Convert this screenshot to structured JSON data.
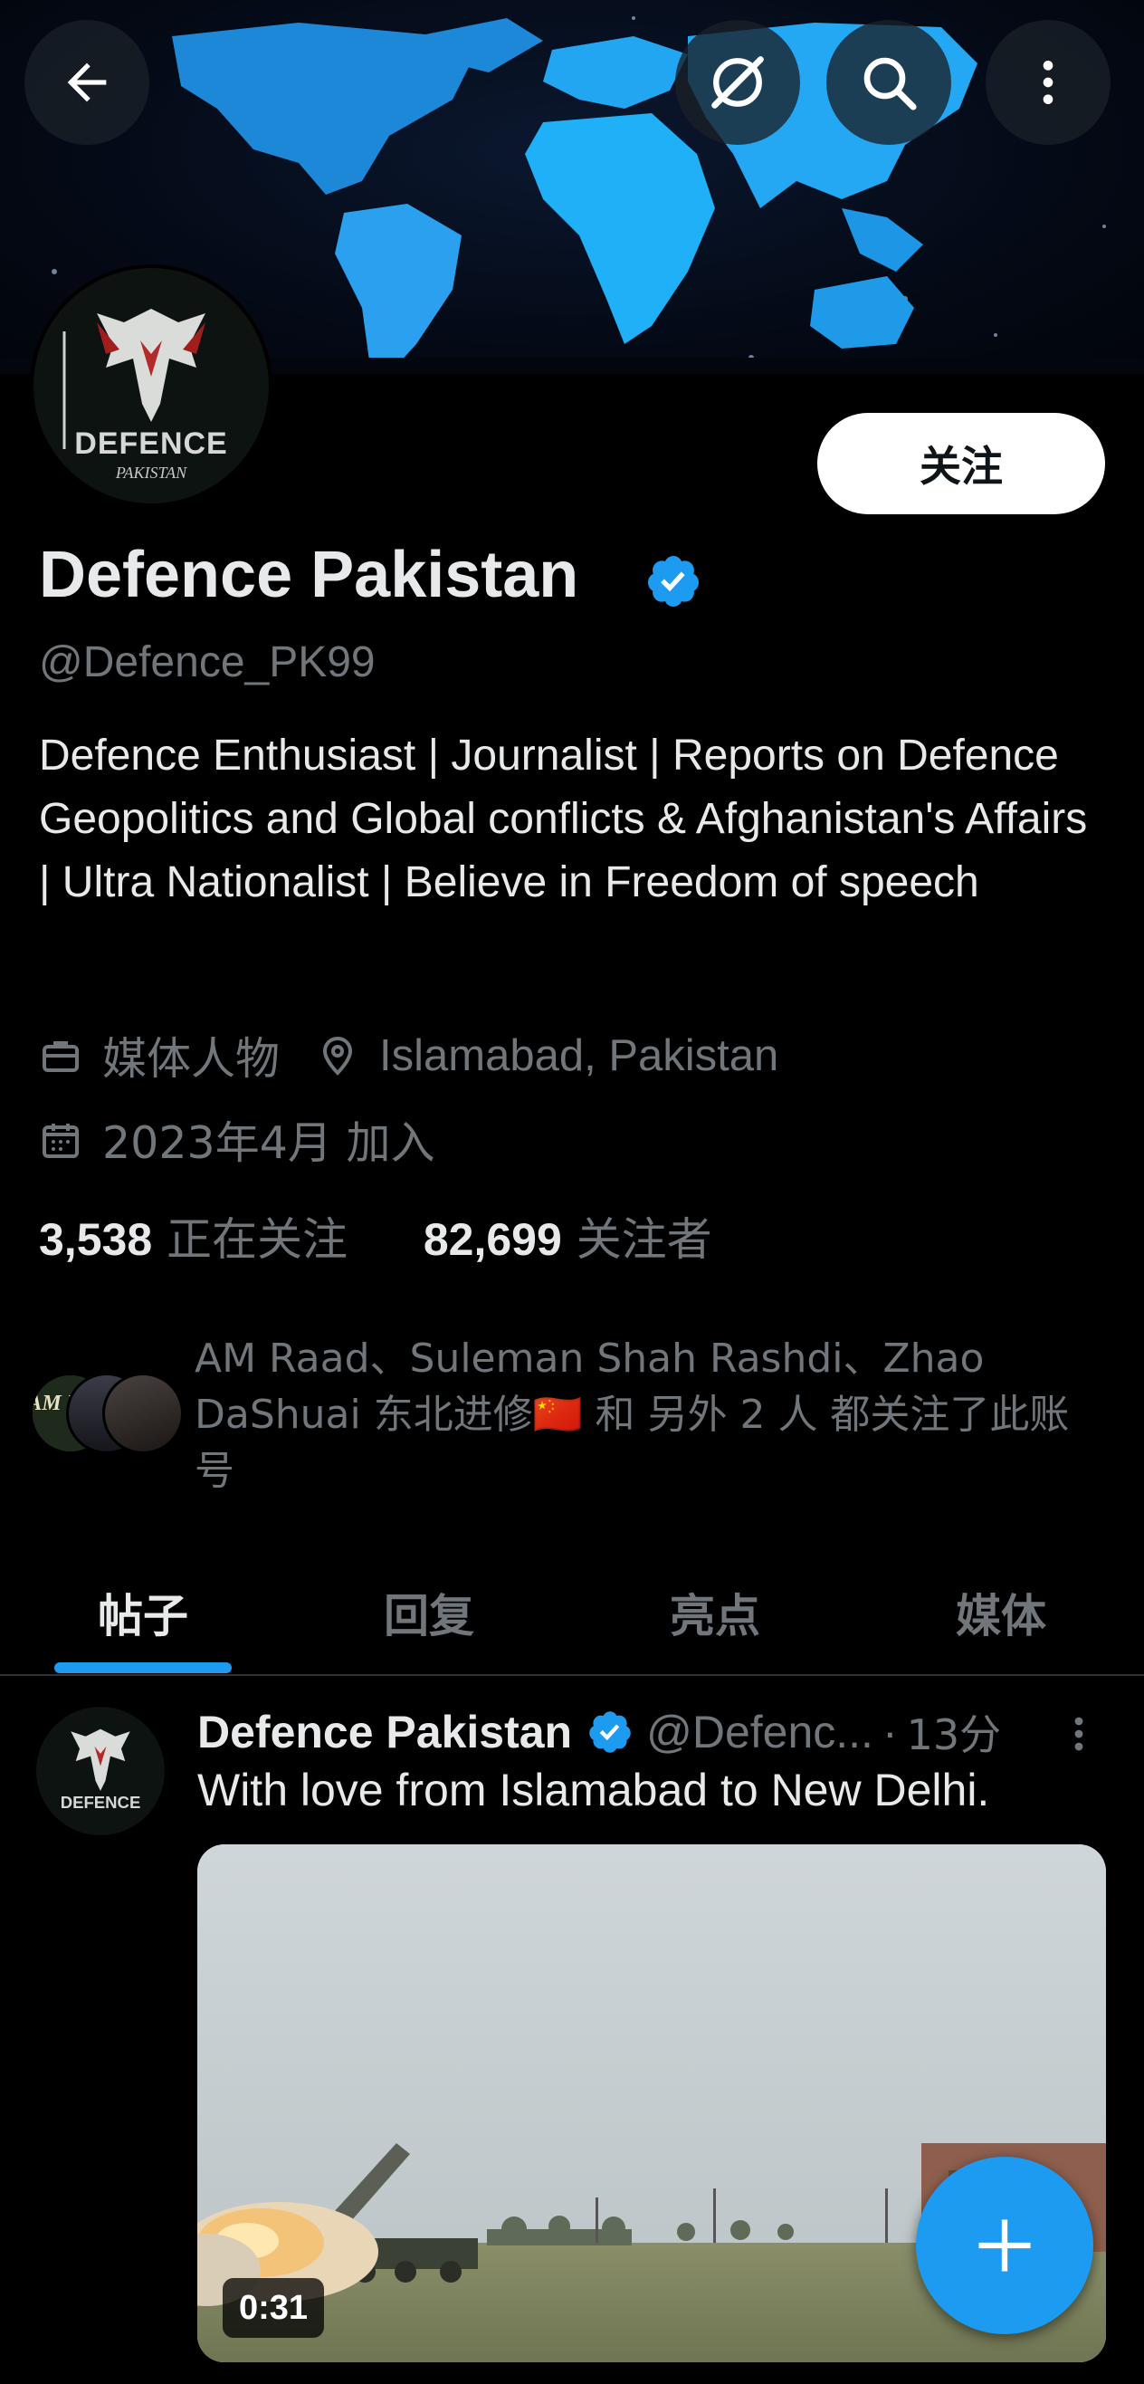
{
  "profile": {
    "display_name": "Defence Pakistan",
    "handle": "@Defence_PK99",
    "bio": "Defence Enthusiast | Journalist | Reports on Defence Geopolitics and Global conflicts & Afghanistan's Affairs | Ultra Nationalist | Believe in Freedom of speech",
    "category": "媒体人物",
    "location": "Islamabad, Pakistan",
    "joined": "2023年4月 加入",
    "following_count": "3,538",
    "following_label": "正在关注",
    "followers_count": "82,699",
    "followers_label": "关注者",
    "follow_button_label": "关注",
    "followed_by_text": "AM Raad、Suleman Shah Rashdi、Zhao DaShuai 东北进修🇨🇳 和 另外 2 人 都关注了此账号",
    "avatar_logo_text": "DEFENCE",
    "avatar_logo_subtext": "PAKISTAN",
    "follower_avatar_text": "AM Raad"
  },
  "tabs": [
    {
      "label": "帖子",
      "active": true
    },
    {
      "label": "回复",
      "active": false
    },
    {
      "label": "亮点",
      "active": false
    },
    {
      "label": "媒体",
      "active": false
    }
  ],
  "post": {
    "author": "Defence Pakistan",
    "handle": "@Defenc...",
    "separator": "·",
    "time": "13分",
    "text": "With love from Islamabad to New Delhi.",
    "video_duration": "0:31"
  },
  "icons": {
    "back": "arrow-left-icon",
    "grok": "grok-icon",
    "search": "search-icon",
    "more": "more-vertical-icon",
    "category": "briefcase-icon",
    "location": "location-pin-icon",
    "joined": "calendar-icon",
    "verified": "verified-badge-icon",
    "compose": "plus-icon"
  },
  "colors": {
    "accent": "#1d9bf0",
    "background": "#000000",
    "text_primary": "#e7e9ea",
    "text_secondary": "#71767b"
  }
}
